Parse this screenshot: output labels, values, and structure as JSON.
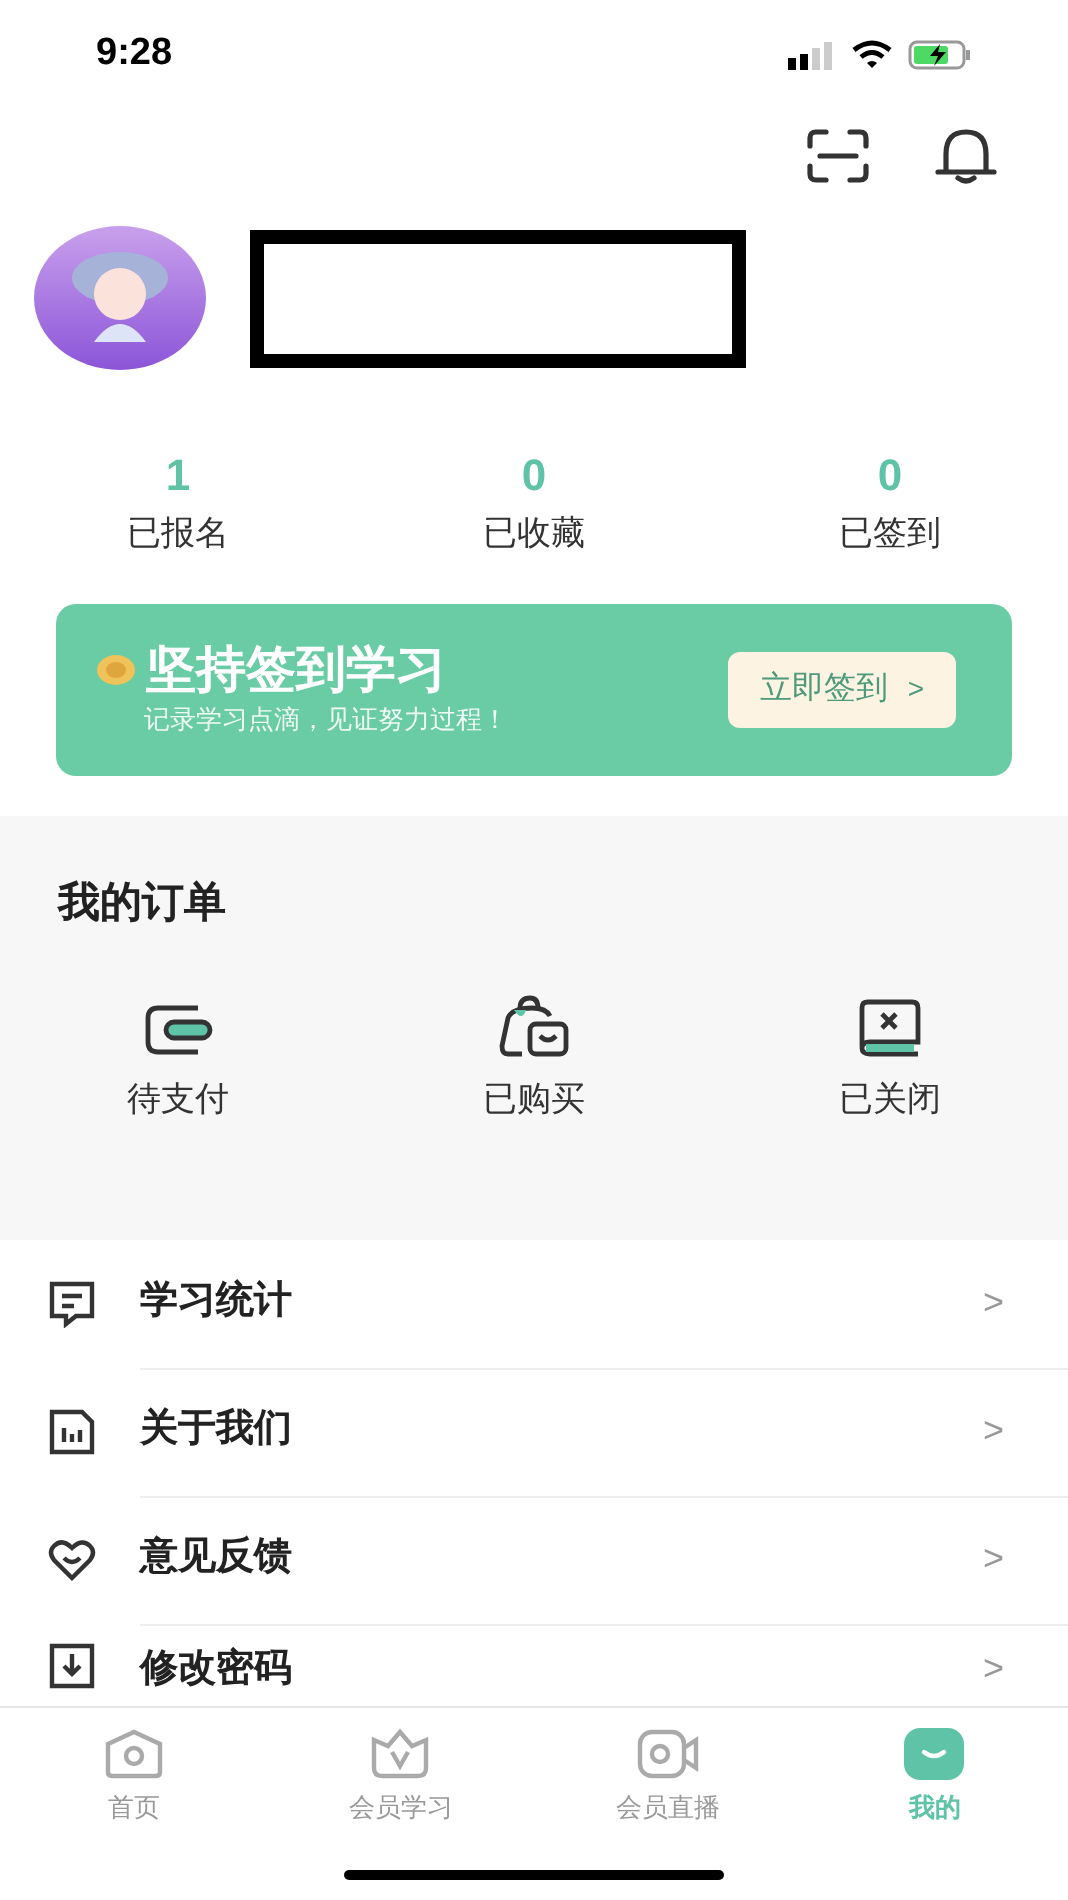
{
  "status_bar": {
    "time": "9:28"
  },
  "stats": [
    {
      "value": "1",
      "label": "已报名"
    },
    {
      "value": "0",
      "label": "已收藏"
    },
    {
      "value": "0",
      "label": "已签到"
    }
  ],
  "banner": {
    "title": "坚持签到学习",
    "subtitle": "记录学习点滴，见证努力过程！",
    "button": "立即签到",
    "button_arrow": ">"
  },
  "orders": {
    "title": "我的订单",
    "items": [
      {
        "kind": "wallet",
        "label": "待支付"
      },
      {
        "kind": "bag",
        "label": "已购买"
      },
      {
        "kind": "closed",
        "label": "已关闭"
      }
    ]
  },
  "menu": [
    {
      "kind": "stats",
      "label": "学习统计",
      "arrow": ">"
    },
    {
      "kind": "about",
      "label": "关于我们",
      "arrow": ">"
    },
    {
      "kind": "feedback",
      "label": "意见反馈",
      "arrow": ">"
    },
    {
      "kind": "password",
      "label": "修改密码",
      "arrow": ">"
    }
  ],
  "tab_bar": [
    {
      "kind": "home",
      "label": "首页",
      "selected": false
    },
    {
      "kind": "vip",
      "label": "会员学习",
      "selected": false
    },
    {
      "kind": "live",
      "label": "会员直播",
      "selected": false
    },
    {
      "kind": "mine",
      "label": "我的",
      "selected": true
    }
  ]
}
